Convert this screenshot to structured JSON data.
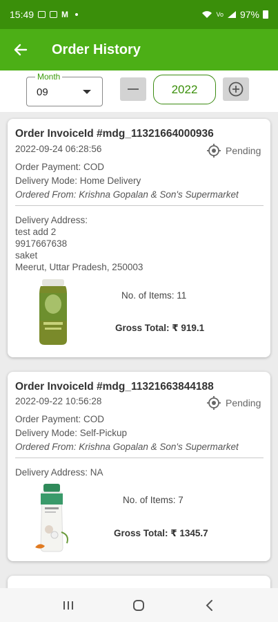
{
  "status_bar": {
    "time": "15:49",
    "battery": "97%"
  },
  "app_bar": {
    "title": "Order History"
  },
  "filter": {
    "month_label": "Month",
    "month_value": "09",
    "year_value": "2022"
  },
  "orders": [
    {
      "title": "Order InvoiceId #mdg_11321664000936",
      "datetime": "2022-09-24 06:28:56",
      "status": "Pending",
      "payment": "Order Payment: COD",
      "delivery_mode": "Delivery Mode: Home Delivery",
      "ordered_from": "Ordered From: Krishna Gopalan & Son's Supermarket",
      "address_label": "Delivery Address:",
      "address_lines": [
        "test add 2",
        "9917667638",
        "saket",
        "Meerut, Uttar Pradesh, 250003"
      ],
      "items": "No. of Items: 11",
      "gross_total": "Gross Total: ₹ 919.1"
    },
    {
      "title": "Order InvoiceId #mdg_11321663844188",
      "datetime": "2022-09-22 10:56:28",
      "status": "Pending",
      "payment": "Order Payment: COD",
      "delivery_mode": "Delivery Mode: Self-Pickup",
      "ordered_from": "Ordered From: Krishna Gopalan & Son's Supermarket",
      "address_label": "Delivery Address: NA",
      "items": "No. of Items: 7",
      "gross_total": "Gross Total: ₹ 1345.7"
    }
  ]
}
